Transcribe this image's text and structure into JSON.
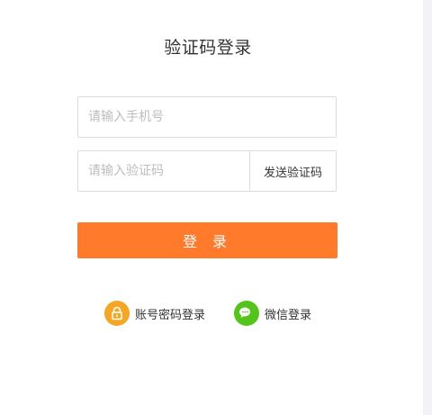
{
  "title": "验证码登录",
  "phone": {
    "placeholder": "请输入手机号",
    "value": ""
  },
  "code": {
    "placeholder": "请输入验证码",
    "value": "",
    "send_label": "发送验证码"
  },
  "login": {
    "label": "登 录"
  },
  "alternatives": [
    {
      "label": "账号密码登录",
      "icon": "lock-icon",
      "color": "#f5a623"
    },
    {
      "label": "微信登录",
      "icon": "wechat-icon",
      "color": "#52c41a"
    }
  ],
  "colors": {
    "accent": "#ff7a2b"
  }
}
